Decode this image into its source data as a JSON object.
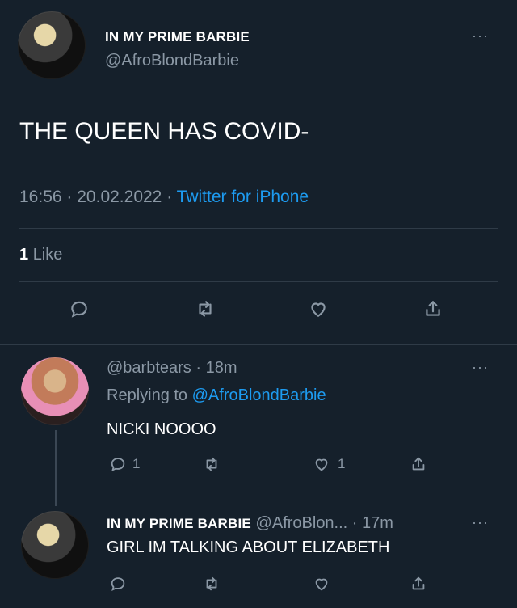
{
  "tweet": {
    "display_name": "IN MY PRIME BARBIE",
    "handle": "@AfroBlondBarbie",
    "text": "THE QUEEN HAS COVID-",
    "time": "16:56",
    "sep1": "·",
    "date": "20.02.2022",
    "sep2": "·",
    "source": "Twitter for iPhone",
    "likes_count": "1",
    "likes_label": "Like",
    "more": "···"
  },
  "reply1": {
    "handle": "@barbtears",
    "sep": "·",
    "age": "18m",
    "replying_prefix": "Replying to",
    "replying_to": "@AfroBlondBarbie",
    "text": "NICKI NOOOO",
    "reply_count": "1",
    "like_count": "1",
    "more": "···"
  },
  "reply2": {
    "display_name": "IN MY PRIME BARBIE",
    "handle": "@AfroBlon...",
    "sep": "·",
    "age": "17m",
    "text": "GIRL IM TALKING ABOUT ELIZABETH",
    "more": "···"
  },
  "icons": {
    "reply": "speech-bubble-icon",
    "retweet": "retweet-icon",
    "like": "heart-icon",
    "share": "share-icon",
    "more": "more-dots-icon"
  },
  "colors": {
    "background": "#15202b",
    "text": "#ffffff",
    "muted": "#8b98a5",
    "link": "#1d9bf0",
    "divider": "#2f3b47"
  }
}
